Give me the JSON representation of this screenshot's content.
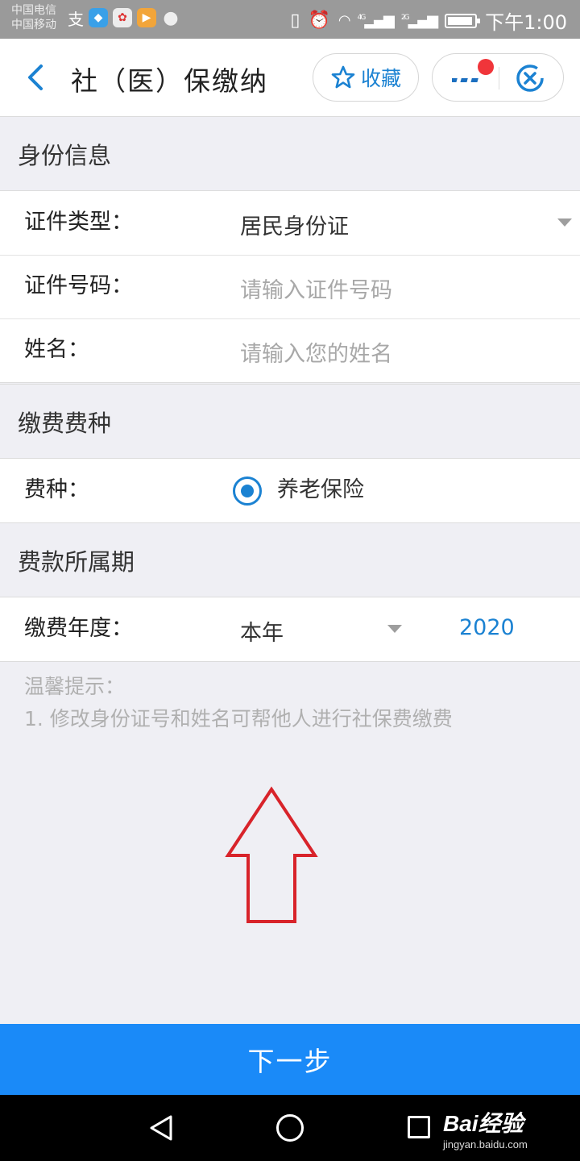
{
  "status_bar": {
    "carrier_1": "中国电信",
    "carrier_2": "中国移动",
    "network_1": "4G",
    "network_2": "2G",
    "time": "下午1:00"
  },
  "header": {
    "title": "社（医）保缴纳",
    "favorite_label": "收藏"
  },
  "sections": {
    "identity": {
      "title": "身份信息",
      "id_type_label": "证件类型：",
      "id_type_value": "居民身份证",
      "id_number_label": "证件号码：",
      "id_number_placeholder": "请输入证件号码",
      "name_label": "姓名：",
      "name_placeholder": "请输入您的姓名"
    },
    "fee_type": {
      "title": "缴费费种",
      "label": "费种：",
      "option": "养老保险"
    },
    "period": {
      "title": "费款所属期",
      "label": "缴费年度：",
      "value": "本年",
      "year": "2020"
    }
  },
  "tips": {
    "title": "温馨提示：",
    "line_1": "1. 修改身份证号和姓名可帮他人进行社保费缴费"
  },
  "next_button": "下一步",
  "watermark": {
    "logo": "Bai经验",
    "url": "jingyan.baidu.com"
  },
  "colors": {
    "accent": "#1b82d2",
    "button": "#1a8af8",
    "annotation_arrow": "#d8232a"
  }
}
